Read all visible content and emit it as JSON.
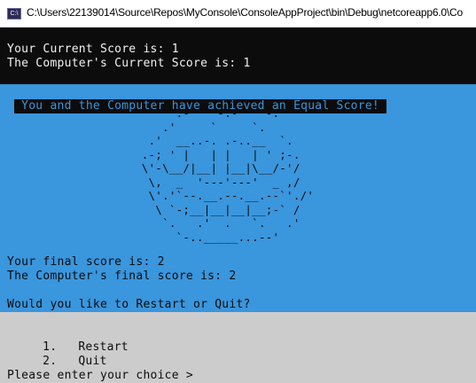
{
  "window": {
    "icon_text": "C:\\",
    "title": "C:\\Users\\22139014\\Source\\Repos\\MyConsole\\ConsoleAppProject\\bin\\Debug\\netcoreapp6.0\\Co"
  },
  "scores": {
    "current": "Your Current Score is: 1",
    "computer_current": "The Computer's Current Score is: 1"
  },
  "result_message": "You and the Computer have achieved an Equal Score!",
  "ascii_art": "               .-\"\"\"\"-.-\"\"\"\"-.\n             .'     `     `.\n           .'  __..-. .-..__  `.\n          .-; ' |   | |   | ' ;-.\n          \\'-\\__/|__| |__|\\__/-'/\n           \\,  _  '---'---'  _ ,/\n           \\'.'`--.__.--.__.--`'./'\n            \\ `-;__|__|__|__;-` /\n             `.   .'  .   `.   .'\n               `-.._____...--'",
  "final": {
    "player": "Your final score is: 2",
    "computer": "The Computer's final score is: 2"
  },
  "prompt": {
    "question": "Would you like to Restart or Quit?",
    "options": [
      {
        "number": "1.",
        "label": "Restart"
      },
      {
        "number": "2.",
        "label": "Quit"
      }
    ],
    "input_label": "Please enter your choice > "
  },
  "colors": {
    "black": "#0c0c0c",
    "blue": "#3a96dd",
    "grey": "#cccccc",
    "white": "#f2f2f2"
  }
}
